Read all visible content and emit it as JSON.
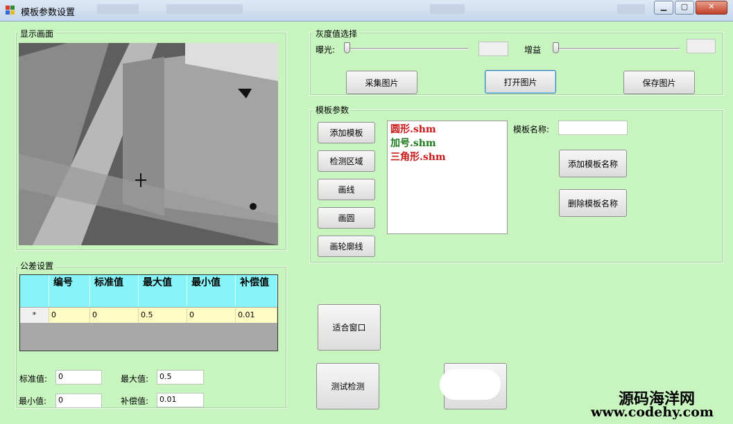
{
  "window": {
    "title": "模板参数设置",
    "buttons": {
      "minimize": "▁",
      "maximize": "▢",
      "close": "✕"
    }
  },
  "display": {
    "legend": "显示画面"
  },
  "gray": {
    "legend": "灰度值选择",
    "exposure_label": "曝光:",
    "gain_label": "增益",
    "exposure_value": "",
    "gain_value": "",
    "capture_button": "采集图片",
    "open_button": "打开图片",
    "save_button": "保存图片"
  },
  "template": {
    "legend": "模板参数",
    "buttons": [
      "添加模板",
      "检测区域",
      "画线",
      "画圆",
      "画轮廓线"
    ],
    "files": [
      {
        "name": "圆形.shm",
        "color": "#c81818"
      },
      {
        "name": "加号.shm",
        "color": "#1e7a1e"
      },
      {
        "name": "三角形.shm",
        "color": "#c81818"
      }
    ],
    "name_label": "模板名称:",
    "name_value": "",
    "add_name_button": "添加模板名称",
    "delete_name_button": "删除模板名称"
  },
  "tolerance": {
    "legend": "公差设置",
    "columns": [
      "编号",
      "标准值",
      "最大值",
      "最小值",
      "补偿值"
    ],
    "row_marker": "*",
    "row": [
      "0",
      "0",
      "0.5",
      "0",
      "0.01"
    ],
    "std_label": "标准值:",
    "std_value": "0",
    "max_label": "最大值:",
    "max_value": "0.5",
    "min_label": "最小值:",
    "min_value": "0",
    "comp_label": "补偿值:",
    "comp_value": "0.01"
  },
  "actions": {
    "fit_window": "适合窗口",
    "test_detect": "测试检测"
  },
  "watermark": {
    "site_cn": "源码海洋网",
    "site_url": "www.codehy.com"
  },
  "colors": {
    "background": "#c8f4c0",
    "header": "#86f4f8",
    "row": "#fffdc4"
  }
}
